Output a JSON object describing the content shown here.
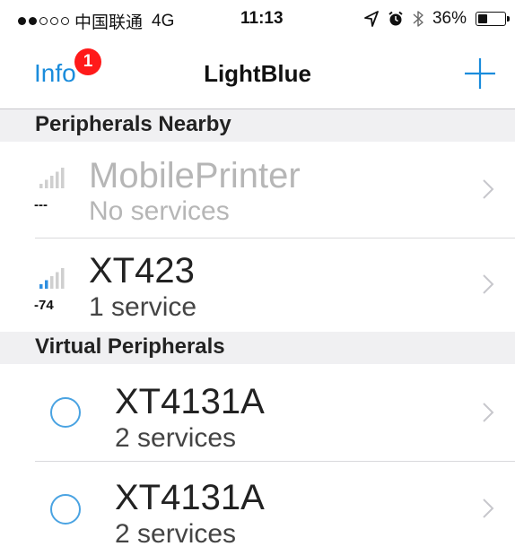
{
  "status_bar": {
    "carrier": "中国联通",
    "network": "4G",
    "time": "11:13",
    "battery": "36%",
    "battery_level": 0.36
  },
  "nav": {
    "info_label": "Info",
    "badge_count": "1",
    "title": "LightBlue",
    "add_icon": "plus-icon"
  },
  "sections": {
    "nearby": "Peripherals Nearby",
    "virtual": "Virtual Peripherals"
  },
  "peripherals": [
    {
      "name": "MobilePrinter",
      "services": "No services",
      "rssi": "---",
      "signal_bars": 0
    },
    {
      "name": "XT423",
      "services": "1 service",
      "rssi": "-74",
      "signal_bars": 2
    }
  ],
  "virtual_peripherals": [
    {
      "name": "XT4131A",
      "services": "2 services"
    },
    {
      "name": "XT4131A",
      "services": "2 services"
    }
  ],
  "colors": {
    "accent": "#1a8cdc",
    "badge": "#ff1a1a",
    "signal_active": "#2f8fe0",
    "signal_inactive": "#cfcfcf",
    "section_bg": "#f0f0f2"
  }
}
